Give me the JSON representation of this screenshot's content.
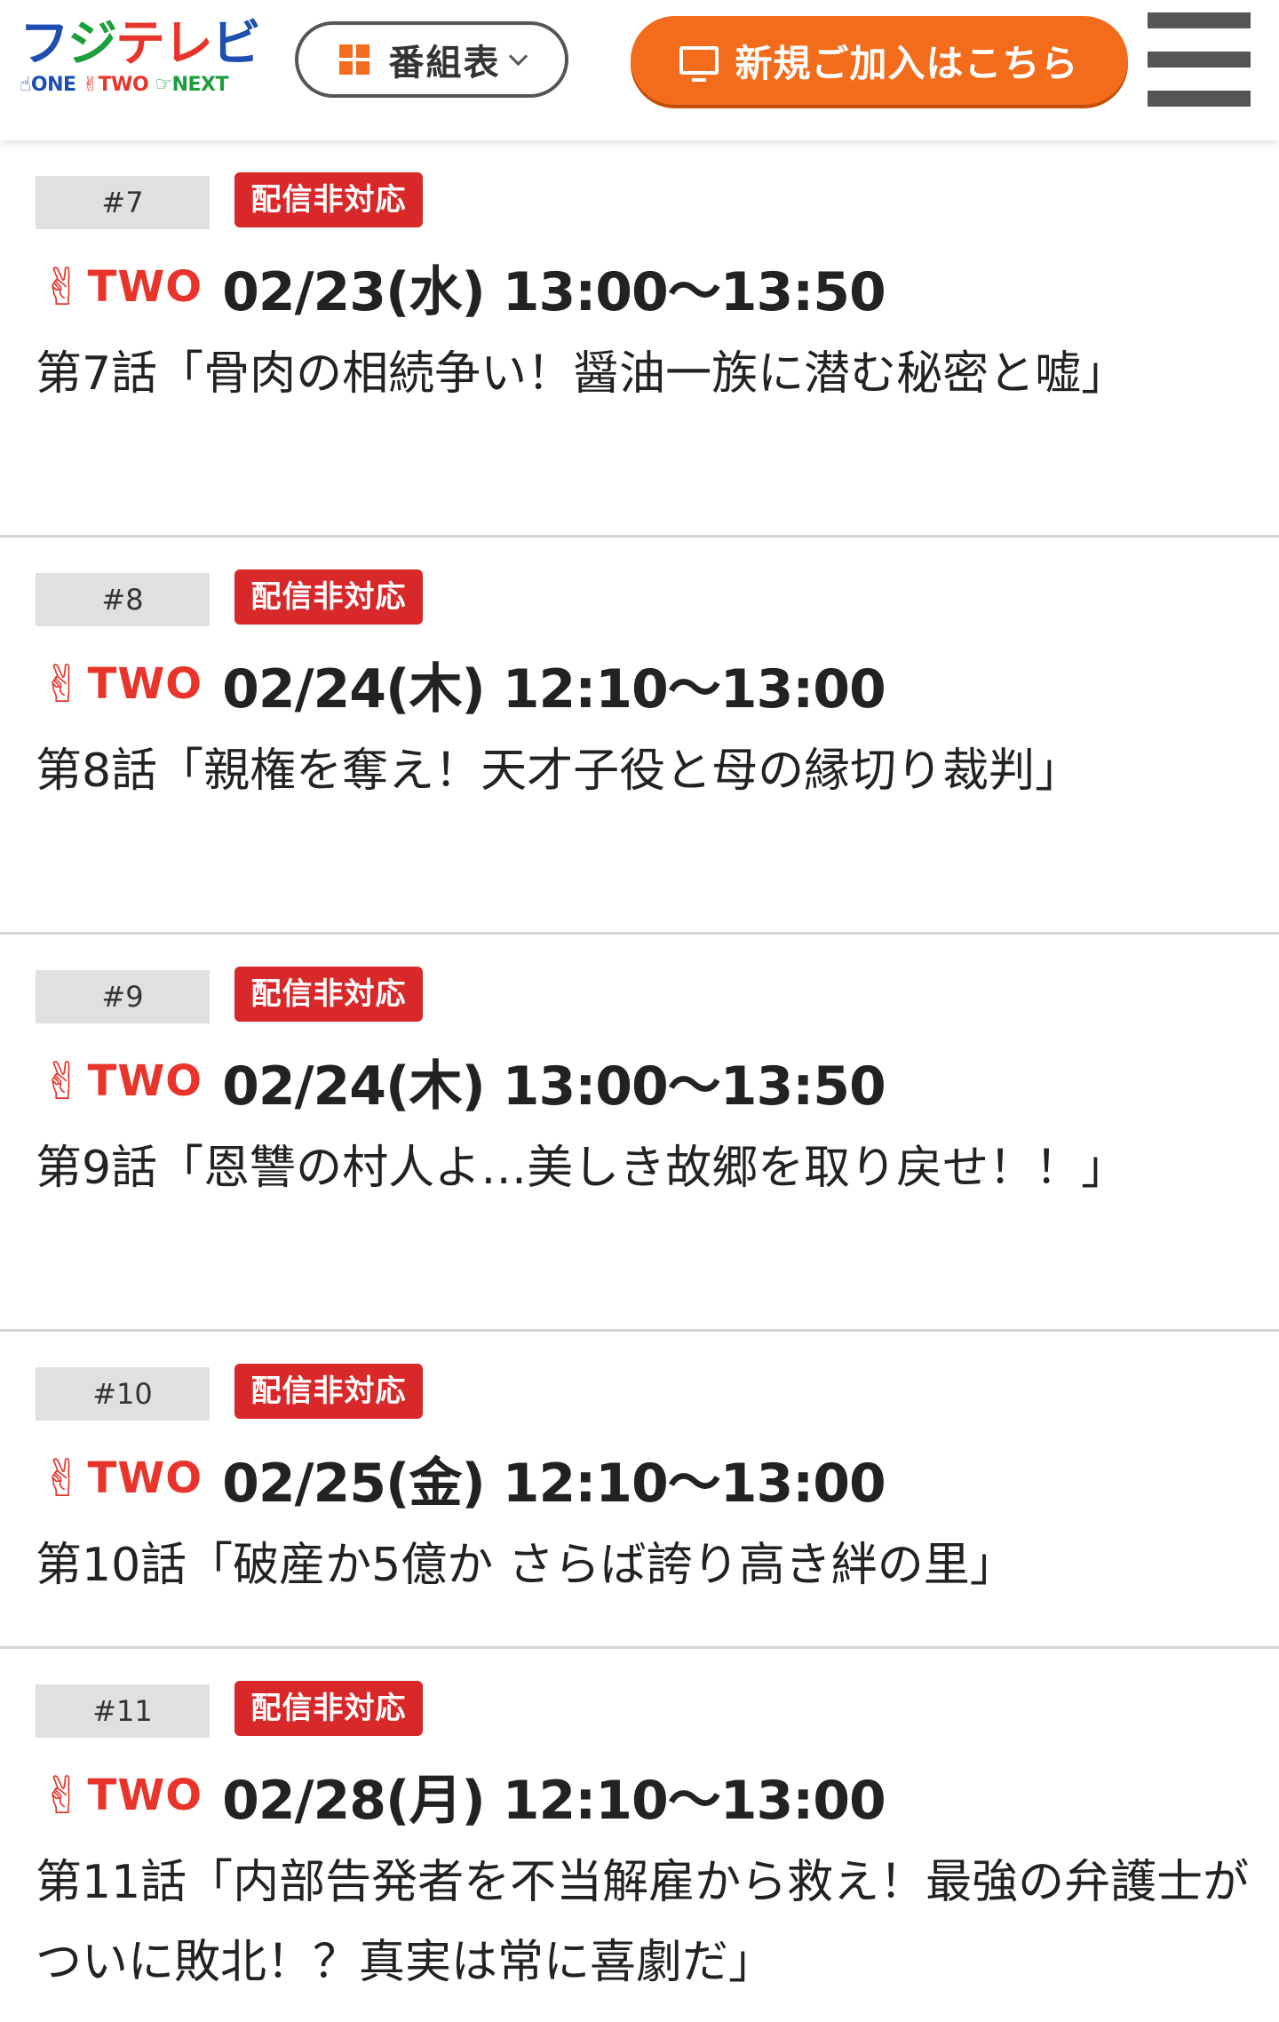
{
  "header": {
    "logo_main": "フジテレビ",
    "logo_one": "ONE",
    "logo_two": "TWO",
    "logo_next": "NEXT",
    "schedule_label": "番組表",
    "join_label": "新規ご加入はこちら"
  },
  "colors": {
    "accent_orange": "#f26c1c",
    "badge_red": "#d8282a",
    "channel_red": "#e8342a"
  },
  "episodes": [
    {
      "number": "#7",
      "badge": "配信非対応",
      "channel": "TWO",
      "airtime": "02/23(水) 13:00〜13:50",
      "title": "第7話「骨肉の相続争い！醤油一族に潜む秘密と嘘」"
    },
    {
      "number": "#8",
      "badge": "配信非対応",
      "channel": "TWO",
      "airtime": "02/24(木) 12:10〜13:00",
      "title": "第8話「親権を奪え！天才子役と母の縁切り裁判」"
    },
    {
      "number": "#9",
      "badge": "配信非対応",
      "channel": "TWO",
      "airtime": "02/24(木) 13:00〜13:50",
      "title": "第9話「恩讐の村人よ…美しき故郷を取り戻せ！！」"
    },
    {
      "number": "#10",
      "badge": "配信非対応",
      "channel": "TWO",
      "airtime": "02/25(金) 12:10〜13:00",
      "title": "第10話「破産か5億か さらば誇り高き絆の里」"
    },
    {
      "number": "#11",
      "badge": "配信非対応",
      "channel": "TWO",
      "airtime": "02/28(月) 12:10〜13:00",
      "title": "第11話「内部告発者を不当解雇から救え！最強の弁護士がついに敗北！？真実は常に喜劇だ」"
    }
  ]
}
